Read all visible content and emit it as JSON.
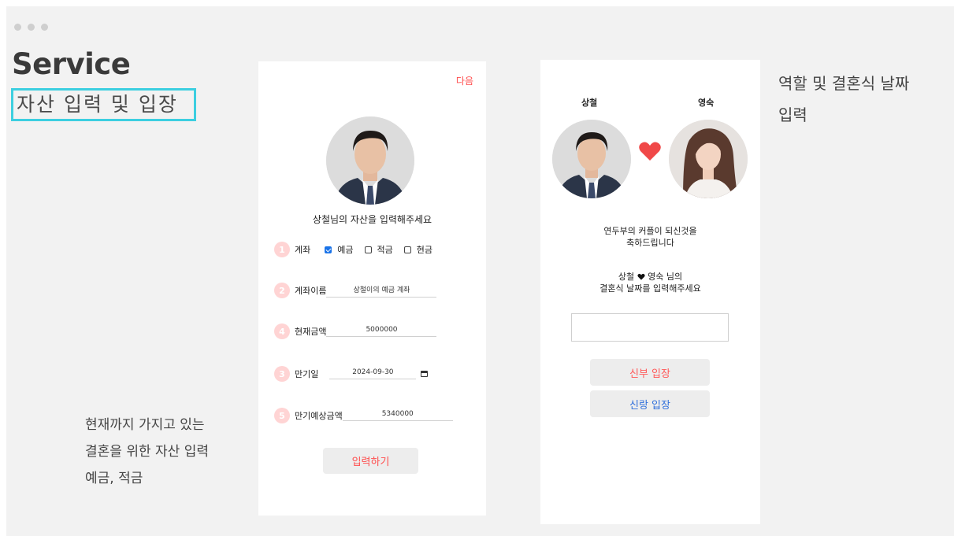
{
  "page": {
    "title": "Service",
    "subtitle": "자산 입력 및 입장",
    "left_description": "현재까지 가지고 있는\n결혼을 위한 자산 입력\n예금, 적금",
    "right_description": "역할 및 결혼식 날짜\n입력"
  },
  "asset_screen": {
    "next_label": "다음",
    "heading": "상철님의 자산을 입력해주세요",
    "account": {
      "step": "1",
      "label": "계좌",
      "options": [
        {
          "label": "예금",
          "checked": true
        },
        {
          "label": "적금",
          "checked": false
        },
        {
          "label": "현금",
          "checked": false
        }
      ]
    },
    "account_name": {
      "step": "2",
      "label": "계좌이름",
      "value": "상철이의 예금 계좌"
    },
    "current_amount": {
      "step": "4",
      "label": "현재금액",
      "value": "5000000"
    },
    "maturity_date": {
      "step": "3",
      "label": "만기일",
      "value": "2024-09-30"
    },
    "expected_amount": {
      "step": "5",
      "label": "만기예상금액",
      "value": "5340000"
    },
    "submit_label": "입력하기"
  },
  "role_screen": {
    "groom_name": "상철",
    "bride_name": "영숙",
    "congrats_line1": "연두부의 커플이 되신것을",
    "congrats_line2": "축하드립니다",
    "couple_prefix": "상철",
    "couple_suffix": "영숙 님의",
    "date_prompt": "결혼식 날짜를 입력해주세요",
    "date_value": "",
    "bride_button": "신부 입장",
    "groom_button": "신랑 입장"
  },
  "colors": {
    "accent_red": "#ff4d4d",
    "accent_blue": "#2f6fdb",
    "highlight_border": "#3ccfe0",
    "step_badge": "#ffd4d4"
  }
}
